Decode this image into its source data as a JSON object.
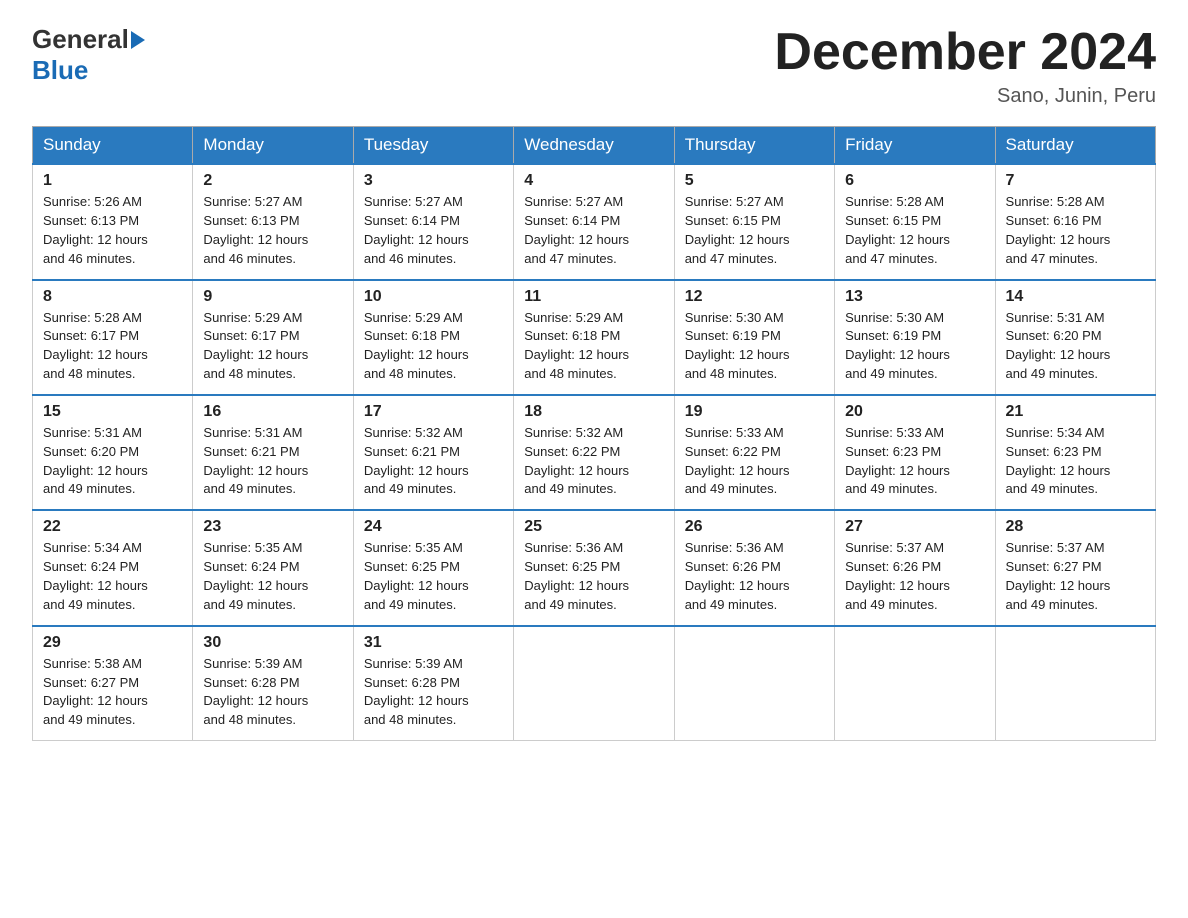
{
  "header": {
    "logo_general": "General",
    "logo_blue": "Blue",
    "month_title": "December 2024",
    "location": "Sano, Junin, Peru"
  },
  "weekdays": [
    "Sunday",
    "Monday",
    "Tuesday",
    "Wednesday",
    "Thursday",
    "Friday",
    "Saturday"
  ],
  "weeks": [
    [
      {
        "day": "1",
        "sunrise": "5:26 AM",
        "sunset": "6:13 PM",
        "daylight": "12 hours and 46 minutes."
      },
      {
        "day": "2",
        "sunrise": "5:27 AM",
        "sunset": "6:13 PM",
        "daylight": "12 hours and 46 minutes."
      },
      {
        "day": "3",
        "sunrise": "5:27 AM",
        "sunset": "6:14 PM",
        "daylight": "12 hours and 46 minutes."
      },
      {
        "day": "4",
        "sunrise": "5:27 AM",
        "sunset": "6:14 PM",
        "daylight": "12 hours and 47 minutes."
      },
      {
        "day": "5",
        "sunrise": "5:27 AM",
        "sunset": "6:15 PM",
        "daylight": "12 hours and 47 minutes."
      },
      {
        "day": "6",
        "sunrise": "5:28 AM",
        "sunset": "6:15 PM",
        "daylight": "12 hours and 47 minutes."
      },
      {
        "day": "7",
        "sunrise": "5:28 AM",
        "sunset": "6:16 PM",
        "daylight": "12 hours and 47 minutes."
      }
    ],
    [
      {
        "day": "8",
        "sunrise": "5:28 AM",
        "sunset": "6:17 PM",
        "daylight": "12 hours and 48 minutes."
      },
      {
        "day": "9",
        "sunrise": "5:29 AM",
        "sunset": "6:17 PM",
        "daylight": "12 hours and 48 minutes."
      },
      {
        "day": "10",
        "sunrise": "5:29 AM",
        "sunset": "6:18 PM",
        "daylight": "12 hours and 48 minutes."
      },
      {
        "day": "11",
        "sunrise": "5:29 AM",
        "sunset": "6:18 PM",
        "daylight": "12 hours and 48 minutes."
      },
      {
        "day": "12",
        "sunrise": "5:30 AM",
        "sunset": "6:19 PM",
        "daylight": "12 hours and 48 minutes."
      },
      {
        "day": "13",
        "sunrise": "5:30 AM",
        "sunset": "6:19 PM",
        "daylight": "12 hours and 49 minutes."
      },
      {
        "day": "14",
        "sunrise": "5:31 AM",
        "sunset": "6:20 PM",
        "daylight": "12 hours and 49 minutes."
      }
    ],
    [
      {
        "day": "15",
        "sunrise": "5:31 AM",
        "sunset": "6:20 PM",
        "daylight": "12 hours and 49 minutes."
      },
      {
        "day": "16",
        "sunrise": "5:31 AM",
        "sunset": "6:21 PM",
        "daylight": "12 hours and 49 minutes."
      },
      {
        "day": "17",
        "sunrise": "5:32 AM",
        "sunset": "6:21 PM",
        "daylight": "12 hours and 49 minutes."
      },
      {
        "day": "18",
        "sunrise": "5:32 AM",
        "sunset": "6:22 PM",
        "daylight": "12 hours and 49 minutes."
      },
      {
        "day": "19",
        "sunrise": "5:33 AM",
        "sunset": "6:22 PM",
        "daylight": "12 hours and 49 minutes."
      },
      {
        "day": "20",
        "sunrise": "5:33 AM",
        "sunset": "6:23 PM",
        "daylight": "12 hours and 49 minutes."
      },
      {
        "day": "21",
        "sunrise": "5:34 AM",
        "sunset": "6:23 PM",
        "daylight": "12 hours and 49 minutes."
      }
    ],
    [
      {
        "day": "22",
        "sunrise": "5:34 AM",
        "sunset": "6:24 PM",
        "daylight": "12 hours and 49 minutes."
      },
      {
        "day": "23",
        "sunrise": "5:35 AM",
        "sunset": "6:24 PM",
        "daylight": "12 hours and 49 minutes."
      },
      {
        "day": "24",
        "sunrise": "5:35 AM",
        "sunset": "6:25 PM",
        "daylight": "12 hours and 49 minutes."
      },
      {
        "day": "25",
        "sunrise": "5:36 AM",
        "sunset": "6:25 PM",
        "daylight": "12 hours and 49 minutes."
      },
      {
        "day": "26",
        "sunrise": "5:36 AM",
        "sunset": "6:26 PM",
        "daylight": "12 hours and 49 minutes."
      },
      {
        "day": "27",
        "sunrise": "5:37 AM",
        "sunset": "6:26 PM",
        "daylight": "12 hours and 49 minutes."
      },
      {
        "day": "28",
        "sunrise": "5:37 AM",
        "sunset": "6:27 PM",
        "daylight": "12 hours and 49 minutes."
      }
    ],
    [
      {
        "day": "29",
        "sunrise": "5:38 AM",
        "sunset": "6:27 PM",
        "daylight": "12 hours and 49 minutes."
      },
      {
        "day": "30",
        "sunrise": "5:39 AM",
        "sunset": "6:28 PM",
        "daylight": "12 hours and 48 minutes."
      },
      {
        "day": "31",
        "sunrise": "5:39 AM",
        "sunset": "6:28 PM",
        "daylight": "12 hours and 48 minutes."
      },
      null,
      null,
      null,
      null
    ]
  ]
}
